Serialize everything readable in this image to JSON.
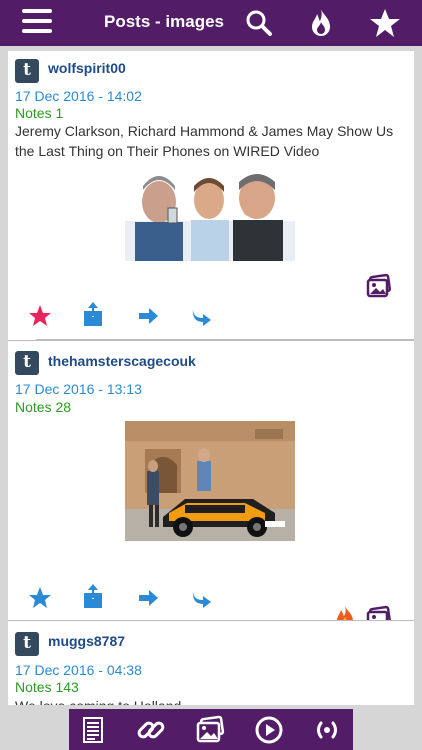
{
  "header": {
    "title": "Posts - images",
    "icons": [
      "menu-icon",
      "search-icon",
      "flame-icon",
      "star-icon"
    ]
  },
  "posts": [
    {
      "username": "wolfspirit00",
      "date": "17 Dec 2016 - 14:02",
      "notes": "Notes 1",
      "body": "Jeremy Clarkson, Richard Hammond & James May Show Us the Last Thing on Their Phones on WIRED Video",
      "badges": [
        "photo-post-icon"
      ],
      "actions": [
        "favorite-star-icon",
        "share-icon",
        "forward-icon",
        "reblog-icon"
      ]
    },
    {
      "username": "thehamsterscagecouk",
      "date": "17 Dec 2016 - 13:13",
      "notes": "Notes 28",
      "body": "",
      "badges": [
        "hot-flame-icon",
        "photo-post-icon"
      ],
      "actions": [
        "favorite-star-icon",
        "share-icon",
        "forward-icon",
        "reblog-icon"
      ]
    },
    {
      "username": "muggs8787",
      "date": "17 Dec 2016 - 04:38",
      "notes": "Notes 143",
      "body": "We love coming to Holland..."
    }
  ],
  "footer": {
    "icons": [
      "text-posts-icon",
      "link-posts-icon",
      "image-posts-icon",
      "video-posts-icon",
      "audio-posts-icon"
    ]
  },
  "colors": {
    "brand": "#521d66",
    "username": "#1f4c88",
    "date": "#2a8ad5",
    "notes": "#2e9a22",
    "action": "#2a8ad5",
    "favorite": "#e8245c",
    "flame": "#ef5a1d"
  }
}
